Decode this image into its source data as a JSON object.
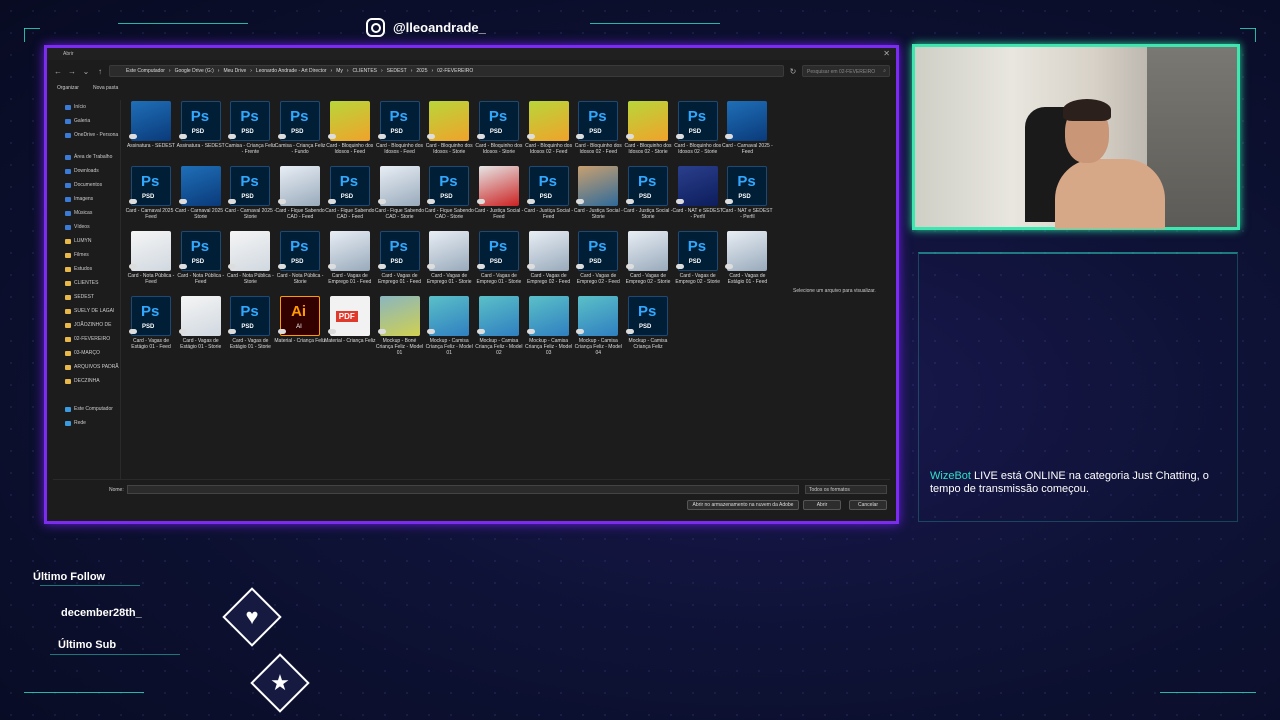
{
  "overlay": {
    "social_handle": "@lleoandrade_",
    "last_follow_label": "Último Follow",
    "last_follow_name": "december28th_",
    "last_sub_label": "Último Sub",
    "accent_color": "#2fe0c8",
    "frame_color": "#7b2cf0",
    "icons": {
      "social": "instagram-icon",
      "follow": "heart-icon",
      "sub": "star-icon"
    }
  },
  "dialog": {
    "title": "Abrir",
    "breadcrumbs": [
      "Este Computador",
      "Google Drive (G:)",
      "Meu Drive",
      "Leonardo Andrade - Art Director",
      "My",
      "CLIENTES",
      "SEDEST",
      "2025",
      "02-FEVEREIRO"
    ],
    "search_placeholder": "Pesquisar em 02-FEVEREIRO",
    "toolbar": {
      "organize": "Organizar",
      "new_folder": "Nova pasta"
    },
    "sidebar": [
      {
        "label": "Início",
        "icon": "home"
      },
      {
        "label": "Galeria",
        "icon": "gallery"
      },
      {
        "label": "OneDrive - Persona",
        "icon": "cloud"
      },
      {
        "label": "Área de Trabalho",
        "icon": "desktop"
      },
      {
        "label": "Downloads",
        "icon": "download"
      },
      {
        "label": "Documentos",
        "icon": "document"
      },
      {
        "label": "Imagens",
        "icon": "image"
      },
      {
        "label": "Músicas",
        "icon": "music"
      },
      {
        "label": "Vídeos",
        "icon": "video"
      },
      {
        "label": "LUMYN",
        "icon": "folder"
      },
      {
        "label": "Filmes",
        "icon": "folder"
      },
      {
        "label": "Estudos",
        "icon": "folder"
      },
      {
        "label": "CLIENTES",
        "icon": "folder"
      },
      {
        "label": "SEDEST",
        "icon": "folder"
      },
      {
        "label": "SUELY DE LAGAI",
        "icon": "folder"
      },
      {
        "label": "JOÃOZINHO DE",
        "icon": "folder"
      },
      {
        "label": "02-FEVEREIRO",
        "icon": "folder"
      },
      {
        "label": "03-MARÇO",
        "icon": "folder"
      },
      {
        "label": "ARQUIVOS PADRÃ",
        "icon": "folder"
      },
      {
        "label": "DECZINHA",
        "icon": "folder"
      },
      {
        "label": "Este Computador",
        "icon": "computer"
      },
      {
        "label": "Rede",
        "icon": "network"
      }
    ],
    "files": [
      {
        "name": "Assinatura - SEDEST",
        "kind": "img-a"
      },
      {
        "name": "Assinatura - SEDEST",
        "kind": "ps"
      },
      {
        "name": "Camisa - Criança Feliz - Frente",
        "kind": "ps"
      },
      {
        "name": "Camisa - Criança Feliz - Fundo",
        "kind": "ps"
      },
      {
        "name": "Card - Bloquinho dos Idosos - Feed",
        "kind": "img-b"
      },
      {
        "name": "Card - Bloquinho dos Idosos - Feed",
        "kind": "ps"
      },
      {
        "name": "Card - Bloquinho dos Idosos - Storie",
        "kind": "img-b"
      },
      {
        "name": "Card - Bloquinho dos Idosos - Storie",
        "kind": "ps"
      },
      {
        "name": "Card - Bloquinho dos Idosos 02 - Feed",
        "kind": "img-b"
      },
      {
        "name": "Card - Bloquinho dos Idosos 02 - Feed",
        "kind": "ps"
      },
      {
        "name": "Card - Bloquinho dos Idosos 02 - Storie",
        "kind": "img-b"
      },
      {
        "name": "Card - Bloquinho dos Idosos 02 - Storie",
        "kind": "ps"
      },
      {
        "name": "Card - Carnaval 2025 - Feed",
        "kind": "img-a"
      },
      {
        "name": "Card - Carnaval 2025 - Feed",
        "kind": "ps"
      },
      {
        "name": "Card - Carnaval 2025 - Storie",
        "kind": "img-a"
      },
      {
        "name": "Card - Carnaval 2025 - Storie",
        "kind": "ps"
      },
      {
        "name": "Card - Fique Sabendo CAD - Feed",
        "kind": "img-c"
      },
      {
        "name": "Card - Fique Sabendo CAD - Feed",
        "kind": "ps"
      },
      {
        "name": "Card - Fique Sabendo CAD - Storie",
        "kind": "img-c"
      },
      {
        "name": "Card - Fique Sabendo CAD - Storie",
        "kind": "ps"
      },
      {
        "name": "Card - Justiça Social - Feed",
        "kind": "img-d"
      },
      {
        "name": "Card - Justiça Social - Feed",
        "kind": "ps"
      },
      {
        "name": "Card - Justiça Social - Storie",
        "kind": "img-g"
      },
      {
        "name": "Card - Justiça Social - Storie",
        "kind": "ps"
      },
      {
        "name": "Card - NAT e SEDEST - Perfil",
        "kind": "img-e"
      },
      {
        "name": "Card - NAT e SEDEST - Perfil",
        "kind": "ps"
      },
      {
        "name": "Card - Nota Pública - Feed",
        "kind": "img-h"
      },
      {
        "name": "Card - Nota Pública - Feed",
        "kind": "ps"
      },
      {
        "name": "Card - Nota Pública - Storie",
        "kind": "img-h"
      },
      {
        "name": "Card - Nota Pública - Storie",
        "kind": "ps"
      },
      {
        "name": "Card - Vagas de Emprego 01 - Feed",
        "kind": "img-c"
      },
      {
        "name": "Card - Vagas de Emprego 01 - Feed",
        "kind": "ps"
      },
      {
        "name": "Card - Vagas de Emprego 01 - Storie",
        "kind": "img-c"
      },
      {
        "name": "Card - Vagas de Emprego 01 - Storie",
        "kind": "ps"
      },
      {
        "name": "Card - Vagas de Emprego 02 - Feed",
        "kind": "img-c"
      },
      {
        "name": "Card - Vagas de Emprego 02 - Feed",
        "kind": "ps"
      },
      {
        "name": "Card - Vagas de Emprego 02 - Storie",
        "kind": "img-c"
      },
      {
        "name": "Card - Vagas de Emprego 02 - Storie",
        "kind": "ps"
      },
      {
        "name": "Card - Vagas de Estágio 01 - Feed",
        "kind": "img-c"
      },
      {
        "name": "Card - Vagas de Estágio 01 - Feed",
        "kind": "ps"
      },
      {
        "name": "Card - Vagas de Estágio 01 - Storie",
        "kind": "img-h"
      },
      {
        "name": "Card - Vagas de Estágio 01 - Storie",
        "kind": "ps"
      },
      {
        "name": "Material - Criança Feliz",
        "kind": "ai"
      },
      {
        "name": "Material - Criança Feliz",
        "kind": "pdf"
      },
      {
        "name": "Mockup - Boné Criança Feliz - Model 01",
        "kind": "img-i"
      },
      {
        "name": "Mockup - Camisa Criança Feliz - Model 01",
        "kind": "img-f"
      },
      {
        "name": "Mockup - Camisa Criança Feliz - Model 02",
        "kind": "img-f"
      },
      {
        "name": "Mockup - Camisa Criança Feliz - Model 03",
        "kind": "img-f"
      },
      {
        "name": "Mockup - Camisa Criança Feliz - Model 04",
        "kind": "img-f"
      },
      {
        "name": "Mockup - Camisa Criança Feliz",
        "kind": "ps"
      }
    ],
    "preview_message": "Selecione um arquivo para visualizar.",
    "name_label": "Nome:",
    "format_select": "Todos os formatos",
    "cloud_button": "Abrir no armazenamento na nuvem da Adobe",
    "open_button": "Abrir",
    "cancel_button": "Cancelar"
  },
  "chat": {
    "bot_name": "WizeBot",
    "message": "LIVE está ONLINE na categoria Just Chatting, o tempo de transmissão começou."
  }
}
